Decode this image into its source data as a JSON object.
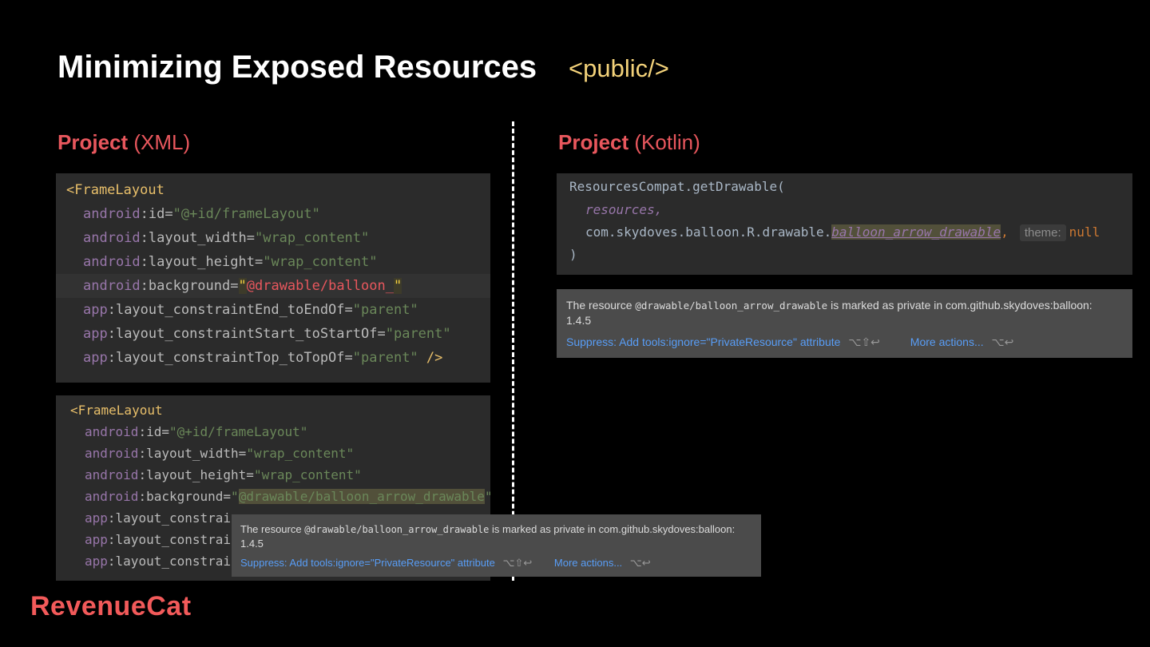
{
  "slide": {
    "title": "Minimizing Exposed Resources",
    "tag": "<public/>"
  },
  "left_section": {
    "bold": "Project",
    "rest": " (XML)"
  },
  "right_section": {
    "bold": "Project",
    "rest": " (Kotlin)"
  },
  "xml_panel_1": {
    "open_tag": "<FrameLayout",
    "lines": [
      {
        "ns": "android",
        "attr": ":id",
        "val": "\"@+id/frameLayout\""
      },
      {
        "ns": "android",
        "attr": ":layout_width",
        "val": "\"wrap_content\""
      },
      {
        "ns": "android",
        "attr": ":layout_height",
        "val": "\"wrap_content\""
      },
      {
        "ns": "android",
        "attr": ":background",
        "q1": "\"",
        "val": "@drawable/balloon_",
        "q2": "\""
      },
      {
        "ns": "app",
        "attr": ":layout_constraintEnd_toEndOf",
        "val": "\"parent\""
      },
      {
        "ns": "app",
        "attr": ":layout_constraintStart_toStartOf",
        "val": "\"parent\""
      },
      {
        "ns": "app",
        "attr": ":layout_constraintTop_toTopOf",
        "val": "\"parent\"",
        "close": " />"
      }
    ]
  },
  "xml_panel_2": {
    "open_tag": "<FrameLayout",
    "lines": [
      {
        "ns": "android",
        "attr": ":id",
        "val": "\"@+id/frameLayout\""
      },
      {
        "ns": "android",
        "attr": ":layout_width",
        "val": "\"wrap_content\""
      },
      {
        "ns": "android",
        "attr": ":layout_height",
        "val": "\"wrap_content\""
      },
      {
        "ns": "android",
        "attr": ":background",
        "q1": "\"",
        "val": "@drawable/balloon_arrow_drawable",
        "q2": "\""
      },
      {
        "ns": "app",
        "attr": ":layout_constrain"
      },
      {
        "ns": "app",
        "attr": ":layout_constrain"
      },
      {
        "ns": "app",
        "attr": ":layout_constrain"
      }
    ]
  },
  "kotlin_panel": {
    "line1": "ResourcesCompat.getDrawable(",
    "line2": "resources,",
    "line3_prefix": "com.skydoves.balloon.R.drawable.",
    "line3_ref": "balloon_arrow_drawable",
    "line3_comma": ",",
    "inlay_hint": "theme:",
    "line3_null": "null",
    "line4": ")"
  },
  "tooltip": {
    "text_prefix": "The resource ",
    "text_mono": "@drawable/balloon_arrow_drawable",
    "text_suffix": " is marked as private in com.github.skydoves:balloon:",
    "text_line2": "1.4.5",
    "suppress_link": "Suppress: Add tools:ignore=\"PrivateResource\" attribute",
    "suppress_shortcut": "⌥⇧↩",
    "more_link": "More actions...",
    "more_shortcut": "⌥↩"
  },
  "logo": {
    "text": "RevenueCat"
  },
  "colors": {
    "background": "#000000",
    "accent_red": "#e8575d",
    "tag_yellow": "#f3d27a",
    "link_blue": "#589df6",
    "panel_bg": "#2b2b2b",
    "tooltip_bg": "#4b4b4b"
  }
}
